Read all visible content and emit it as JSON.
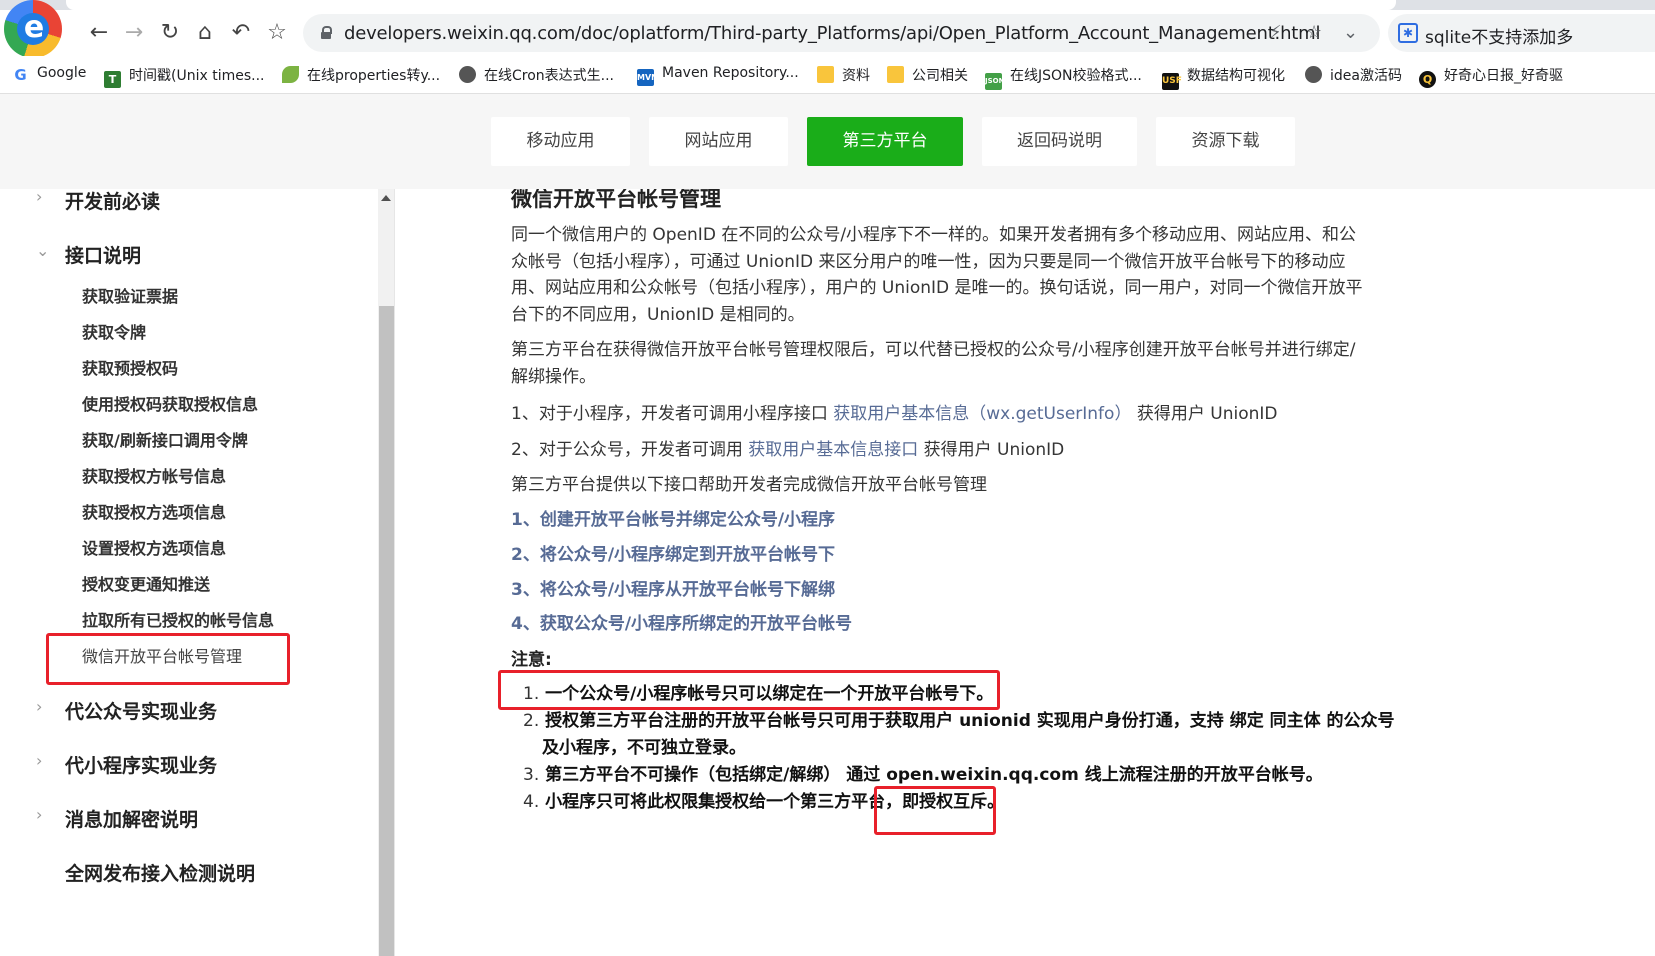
{
  "browser": {
    "url": "developers.weixin.qq.com/doc/oplatform/Third-party_Platforms/api/Open_Platform_Account_Management.html",
    "extension_text": "sqlite不支持添加多",
    "bookmarks": [
      {
        "label": "Google",
        "icon": "google-icon",
        "color": "#4285f4"
      },
      {
        "label": "时间戳(Unix times...",
        "icon": "clock-icon",
        "color": "#2e7d32"
      },
      {
        "label": "在线properties转y...",
        "icon": "leaf-icon",
        "color": "#7cb342"
      },
      {
        "label": "在线Cron表达式生...",
        "icon": "globe-icon",
        "color": "#555555"
      },
      {
        "label": "Maven Repository...",
        "icon": "maven-icon",
        "color": "#1565c0"
      },
      {
        "label": "资料",
        "icon": "folder-icon",
        "color": "#f9c53c"
      },
      {
        "label": "公司相关",
        "icon": "folder-icon",
        "color": "#f9c53c"
      },
      {
        "label": "在线JSON校验格式...",
        "icon": "json-icon",
        "color": "#43a047"
      },
      {
        "label": "数据结构可视化",
        "icon": "usf-icon",
        "color": "#111111"
      },
      {
        "label": "idea激活码",
        "icon": "globe-icon",
        "color": "#555555"
      },
      {
        "label": "好奇心日报_好奇驱",
        "icon": "q-icon",
        "color": "#111111"
      }
    ]
  },
  "site_nav": {
    "items": [
      "移动应用",
      "网站应用",
      "第三方平台",
      "返回码说明",
      "资源下载"
    ],
    "active_index": 2,
    "accent": "#1aad19"
  },
  "sidebar": {
    "groups": [
      {
        "label": "开发前必读",
        "expanded": false
      },
      {
        "label": "接口说明",
        "expanded": true
      },
      {
        "label": "代公众号实现业务",
        "expanded": false
      },
      {
        "label": "代小程序实现业务",
        "expanded": false
      },
      {
        "label": "消息加解密说明",
        "expanded": false
      },
      {
        "label": "全网发布接入检测说明",
        "expanded": false
      }
    ],
    "items": [
      "获取验证票据",
      "获取令牌",
      "获取预授权码",
      "使用授权码获取授权信息",
      "获取/刷新接口调用令牌",
      "获取授权方帐号信息",
      "获取授权方选项信息",
      "设置授权方选项信息",
      "授权变更通知推送",
      "拉取所有已授权的帐号信息",
      "微信开放平台帐号管理"
    ],
    "current_index": 10
  },
  "content": {
    "title": "微信开放平台帐号管理",
    "para1": "同一个微信用户的 OpenID 在不同的公众号/小程序下不一样的。如果开发者拥有多个移动应用、网站应用、和公众帐号（包括小程序），可通过 UnionID 来区分用户的唯一性，因为只要是同一个微信开放平台帐号下的移动应用、网站应用和公众帐号（包括小程序），用户的 UnionID 是唯一的。换句话说，同一用户，对同一个微信开放平台下的不同应用，UnionID 是相同的。",
    "para2": "第三方平台在获得微信开放平台帐号管理权限后，可以代替已授权的公众号/小程序创建开放平台帐号并进行绑定/解绑操作。",
    "item1_prefix": "1、对于小程序，开发者可调用小程序接口 ",
    "item1_link": "获取用户基本信息（wx.getUserInfo）",
    "item1_suffix": " 获得用户 UnionID",
    "item2_prefix": "2、对于公众号，开发者可调用 ",
    "item2_link": "获取用户基本信息接口",
    "item2_suffix": " 获得用户 UnionID",
    "intro": "第三方平台提供以下接口帮助开发者完成微信开放平台帐号管理",
    "op_links": [
      "1、创建开放平台帐号并绑定公众号/小程序",
      "2、将公众号/小程序绑定到开放平台帐号下",
      "3、将公众号/小程序从开放平台帐号下解绑",
      "4、获取公众号/小程序所绑定的开放平台帐号"
    ],
    "note_title": "注意:",
    "notes": [
      {
        "num": "1.",
        "text": "一个公众号/小程序帐号只可以绑定在一个开放平台帐号下。"
      },
      {
        "num": "2.",
        "text": "授权第三方平台注册的开放平台帐号只可用于获取用户 unionid 实现用户身份打通，支持 绑定 同主体 的公众号",
        "cont": "及小程序，不可独立登录。"
      },
      {
        "num": "3.",
        "text": "第三方平台不可操作（包括绑定/解绑） 通过 open.weixin.qq.com 线上流程注册的开放平台帐号。"
      },
      {
        "num": "4.",
        "text": "小程序只可将此权限集授权给一个第三方平台，即授权互斥。"
      }
    ],
    "annotation_color": "#e8202a"
  }
}
